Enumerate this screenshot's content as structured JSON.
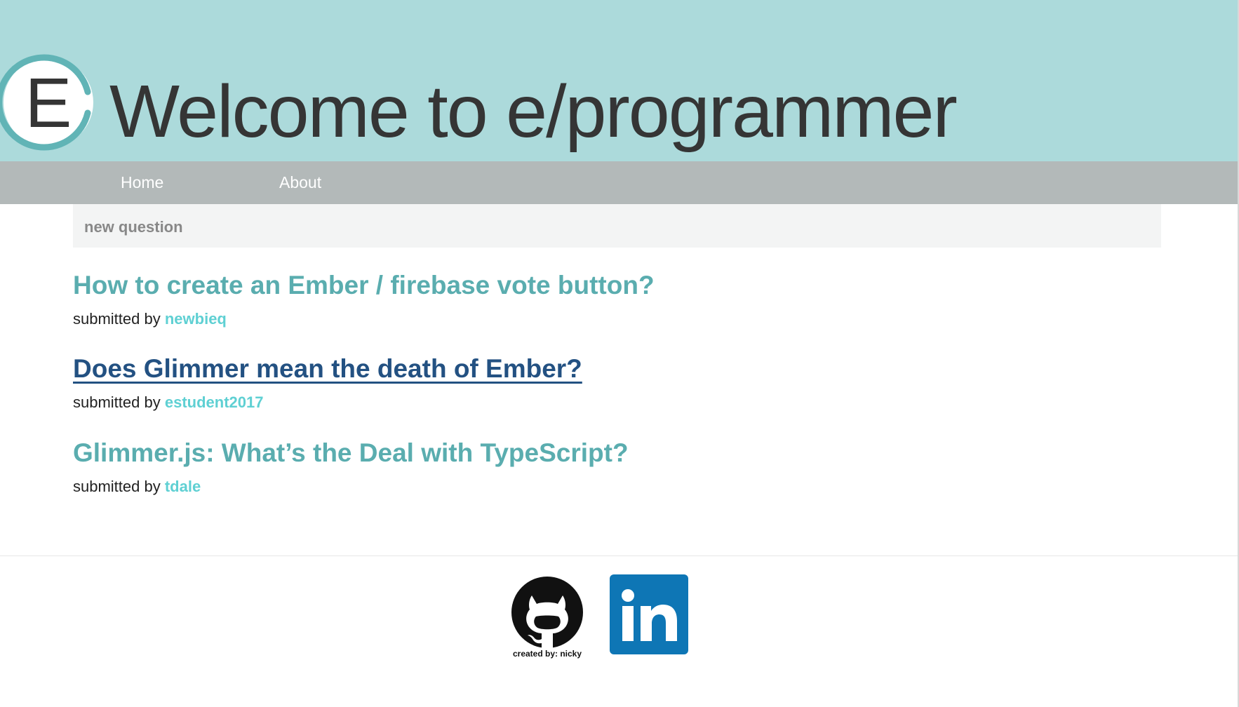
{
  "header": {
    "logo_letter": "E",
    "title": "Welcome to e/programmer"
  },
  "nav": {
    "items": [
      {
        "label": "Home"
      },
      {
        "label": "About"
      }
    ]
  },
  "actions": {
    "new_question_label": "new question"
  },
  "questions": [
    {
      "title": "How to create an Ember / firebase vote button?",
      "submitted_prefix": "submitted by",
      "author": "newbieq"
    },
    {
      "title": "Does Glimmer mean the death of Ember?",
      "submitted_prefix": "submitted by",
      "author": "estudent2017",
      "state": "hovered"
    },
    {
      "title": "Glimmer.js: What’s the Deal with TypeScript?",
      "submitted_prefix": "submitted by",
      "author": "tdale"
    }
  ],
  "footer": {
    "github_icon": "github-icon",
    "credit": "created by: nicky",
    "linkedin_icon": "linkedin-icon",
    "linkedin_text": "in"
  },
  "colors": {
    "header_bg": "#acdadb",
    "nav_bg": "#b3b9b9",
    "link": "#5aadaf",
    "link_hover": "#235182",
    "author": "#5fd0d3",
    "linkedin_blue": "#0e76b5"
  }
}
